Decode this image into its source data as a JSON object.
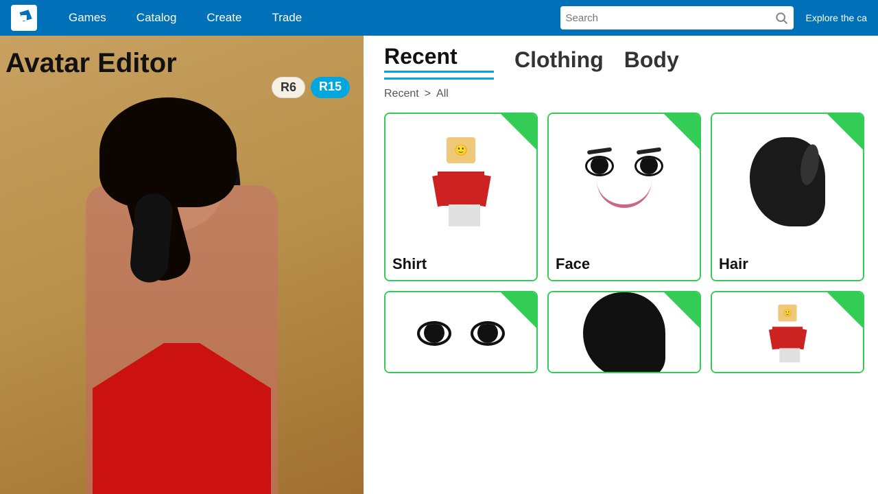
{
  "navbar": {
    "logo_alt": "Roblox Logo",
    "links": [
      "Games",
      "Catalog",
      "Create",
      "Trade"
    ],
    "search_placeholder": "Search",
    "explore_text": "Explore the ca"
  },
  "page": {
    "title": "Avatar Editor",
    "avatar_badge_r6": "R6",
    "avatar_badge_r15": "R15"
  },
  "tabs": [
    {
      "id": "recent",
      "label": "Recent",
      "active": true
    },
    {
      "id": "clothing",
      "label": "Clothing",
      "active": false
    },
    {
      "id": "body",
      "label": "Body",
      "active": false
    }
  ],
  "breadcrumb": {
    "parent": "Recent",
    "separator": ">",
    "current": "All"
  },
  "grid_items": [
    {
      "id": "shirt",
      "label": "Shirt",
      "type": "shirt"
    },
    {
      "id": "face",
      "label": "Face",
      "type": "face"
    },
    {
      "id": "hair",
      "label": "Hair",
      "type": "hair"
    },
    {
      "id": "eyes",
      "label": "",
      "type": "eyes"
    },
    {
      "id": "hair2",
      "label": "",
      "type": "hair2"
    },
    {
      "id": "shirt2",
      "label": "",
      "type": "shirt2"
    }
  ]
}
